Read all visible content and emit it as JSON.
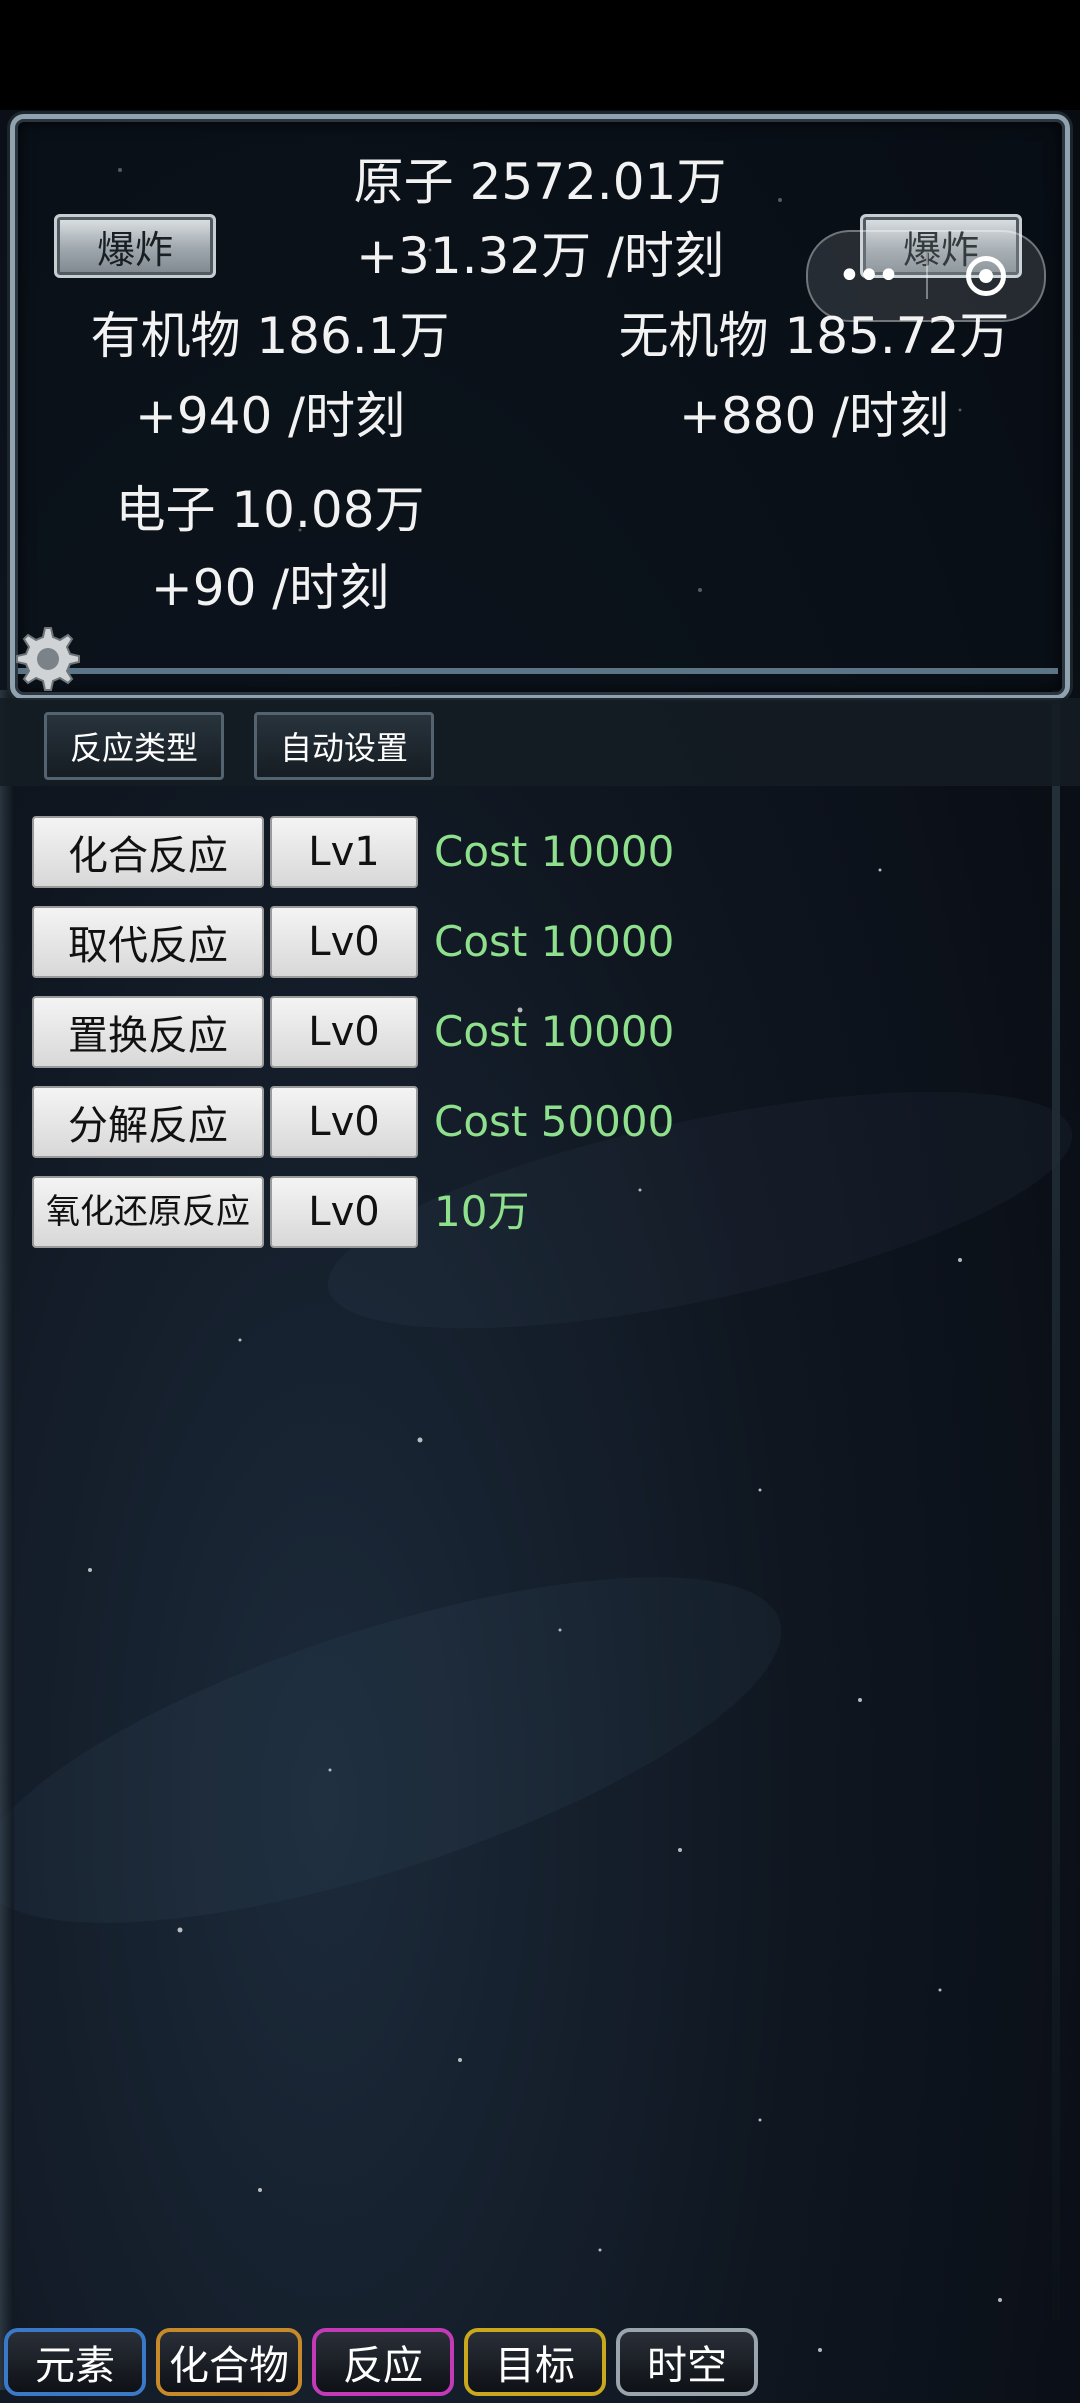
{
  "header": {
    "atom": {
      "label": "原子 2572.01万",
      "rate": "+31.32万 /时刻"
    },
    "organic": {
      "label": "有机物 186.1万",
      "rate": "+940 /时刻"
    },
    "inorganic": {
      "label": "无机物 185.72万",
      "rate": "+880 /时刻"
    },
    "electron": {
      "label": "电子 10.08万",
      "rate": "+90 /时刻"
    },
    "burst_left_label": "爆炸",
    "burst_right_label": "爆炸",
    "capsule_more": "•••"
  },
  "subtabs": {
    "reaction_type": "反应类型",
    "auto_settings": "自动设置"
  },
  "reactions": [
    {
      "name": "化合反应",
      "level": "Lv1",
      "cost": "Cost 10000"
    },
    {
      "name": "取代反应",
      "level": "Lv0",
      "cost": "Cost 10000"
    },
    {
      "name": "置换反应",
      "level": "Lv0",
      "cost": "Cost 10000"
    },
    {
      "name": "分解反应",
      "level": "Lv0",
      "cost": "Cost 50000"
    },
    {
      "name": "氧化还原反应",
      "level": "Lv0",
      "cost": "10万"
    }
  ],
  "bottom_nav": [
    {
      "label": "元素",
      "color": "#3a78c8"
    },
    {
      "label": "化合物",
      "color": "#c78a2a"
    },
    {
      "label": "反应",
      "color": "#c23ab8"
    },
    {
      "label": "目标",
      "color": "#c9a81d"
    },
    {
      "label": "时空",
      "color": "#9aa4ad"
    }
  ]
}
